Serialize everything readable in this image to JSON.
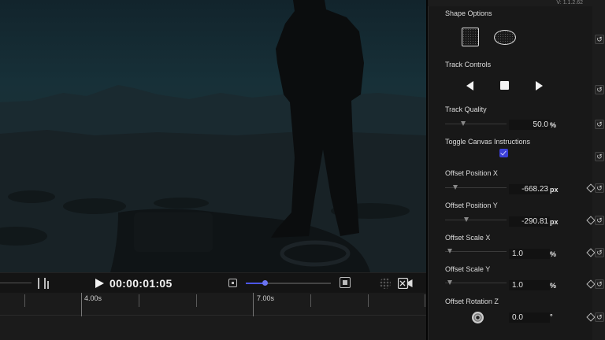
{
  "panel": {
    "version": "V: 1.1.2.62",
    "sections": {
      "shape_options": {
        "label": "Shape Options",
        "shapes": [
          "rectangle-icon",
          "ellipse-icon"
        ]
      },
      "track_controls": {
        "label": "Track Controls",
        "buttons": [
          "track-previous-icon",
          "stop-icon",
          "track-next-icon"
        ]
      },
      "track_quality": {
        "label": "Track Quality",
        "value": "50.0",
        "unit": "%",
        "slider_fraction": 0.5
      },
      "toggle_canvas": {
        "label": "Toggle Canvas Instructions",
        "checked": true
      },
      "offset_position_x": {
        "label": "Offset Position X",
        "value": "-668.23",
        "unit": "px"
      },
      "offset_position_y": {
        "label": "Offset Position Y",
        "value": "-290.81",
        "unit": "px"
      },
      "offset_scale_x": {
        "label": "Offset Scale X",
        "value": "1.0",
        "unit": "%"
      },
      "offset_scale_y": {
        "label": "Offset Scale Y",
        "value": "1.0",
        "unit": "%"
      },
      "offset_rotation_z": {
        "label": "Offset Rotation Z",
        "value": "0.0",
        "unit": "°"
      }
    }
  },
  "transport": {
    "timecode": "00:00:01:05",
    "zoom_level": 0.22
  },
  "timeline": {
    "markers": [
      {
        "label": "4.00s"
      },
      {
        "label": "7.00s"
      }
    ]
  },
  "colors": {
    "accent": "#3b3fd8",
    "background": "#111111",
    "panel": "#1c1c1c"
  }
}
